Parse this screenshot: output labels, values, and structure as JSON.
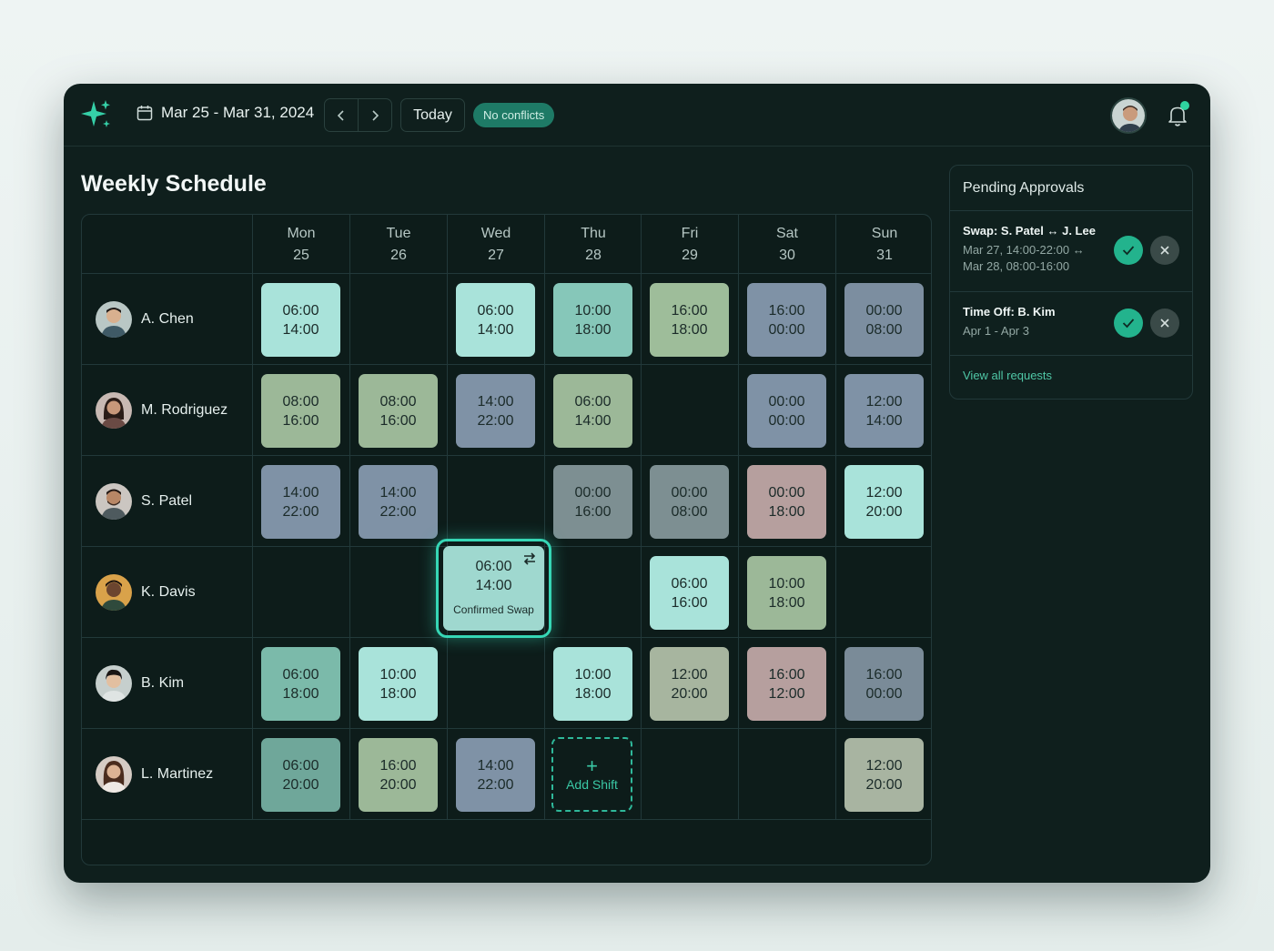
{
  "header": {
    "date_range": "Mar 25 - Mar 31, 2024",
    "today_label": "Today",
    "status_badge": "No conflicts",
    "icons": [
      "sparkle-logo-icon",
      "calendar-icon",
      "chevron-left-icon",
      "chevron-right-icon",
      "bell-icon"
    ]
  },
  "page_title": "Weekly Schedule",
  "days": [
    {
      "name": "Mon",
      "date": "25"
    },
    {
      "name": "Tue",
      "date": "26"
    },
    {
      "name": "Wed",
      "date": "27"
    },
    {
      "name": "Thu",
      "date": "28"
    },
    {
      "name": "Fri",
      "date": "29"
    },
    {
      "name": "Sat",
      "date": "30"
    },
    {
      "name": "Sun",
      "date": "31"
    }
  ],
  "employees": [
    {
      "name": "A. Chen"
    },
    {
      "name": "M. Rodriguez"
    },
    {
      "name": "S. Patel"
    },
    {
      "name": "K. Davis"
    },
    {
      "name": "B. Kim"
    },
    {
      "name": "L. Martinez"
    }
  ],
  "shifts": {
    "chen_mon": {
      "start": "06:00",
      "end": "14:00"
    },
    "chen_wed": {
      "start": "06:00",
      "end": "14:00"
    },
    "chen_thu": {
      "start": "10:00",
      "end": "18:00"
    },
    "chen_fri": {
      "start": "16:00",
      "end": "18:00"
    },
    "chen_sat": {
      "start": "16:00",
      "end": "00:00"
    },
    "chen_sun": {
      "start": "00:00",
      "end": "08:00"
    },
    "rod_mon": {
      "start": "08:00",
      "end": "16:00"
    },
    "rod_tue": {
      "start": "08:00",
      "end": "16:00"
    },
    "rod_wed": {
      "start": "14:00",
      "end": "22:00"
    },
    "rod_thu": {
      "start": "06:00",
      "end": "14:00"
    },
    "rod_sat": {
      "start": "00:00",
      "end": "00:00"
    },
    "rod_sun": {
      "start": "12:00",
      "end": "14:00"
    },
    "pat_mon": {
      "start": "14:00",
      "end": "22:00"
    },
    "pat_tue": {
      "start": "14:00",
      "end": "22:00"
    },
    "pat_thu": {
      "start": "00:00",
      "end": "16:00"
    },
    "pat_fri": {
      "start": "00:00",
      "end": "08:00"
    },
    "pat_sat": {
      "start": "00:00",
      "end": "18:00"
    },
    "pat_sun": {
      "start": "12:00",
      "end": "20:00"
    },
    "dav_wed": {
      "start": "06:00",
      "end": "14:00",
      "label": "Confirmed Swap"
    },
    "dav_fri": {
      "start": "06:00",
      "end": "16:00"
    },
    "dav_sat": {
      "start": "10:00",
      "end": "18:00"
    },
    "kim_mon": {
      "start": "06:00",
      "end": "18:00"
    },
    "kim_tue": {
      "start": "10:00",
      "end": "18:00"
    },
    "kim_thu": {
      "start": "10:00",
      "end": "18:00"
    },
    "kim_fri": {
      "start": "12:00",
      "end": "20:00"
    },
    "kim_sat": {
      "start": "16:00",
      "end": "12:00"
    },
    "kim_sun": {
      "start": "16:00",
      "end": "00:00"
    },
    "mar_mon": {
      "start": "06:00",
      "end": "20:00"
    },
    "mar_tue": {
      "start": "16:00",
      "end": "20:00"
    },
    "mar_wed": {
      "start": "14:00",
      "end": "22:00"
    },
    "mar_sun": {
      "start": "12:00",
      "end": "20:00"
    }
  },
  "add_shift_label": "Add Shift",
  "approvals": {
    "title": "Pending Approvals",
    "items": [
      {
        "title": "Swap: S. Patel ↔ J. Lee",
        "line1": "Mar 27, 14:00-22:00 ↔",
        "line2": "Mar 28, 08:00-16:00"
      },
      {
        "title": "Time Off: B. Kim",
        "line1": "Apr 1 - Apr 3"
      }
    ],
    "view_all": "View all requests"
  },
  "colors": {
    "accent": "#2fd3a0",
    "background": "#0f1f1d",
    "badge_bg": "#1e7a66"
  }
}
